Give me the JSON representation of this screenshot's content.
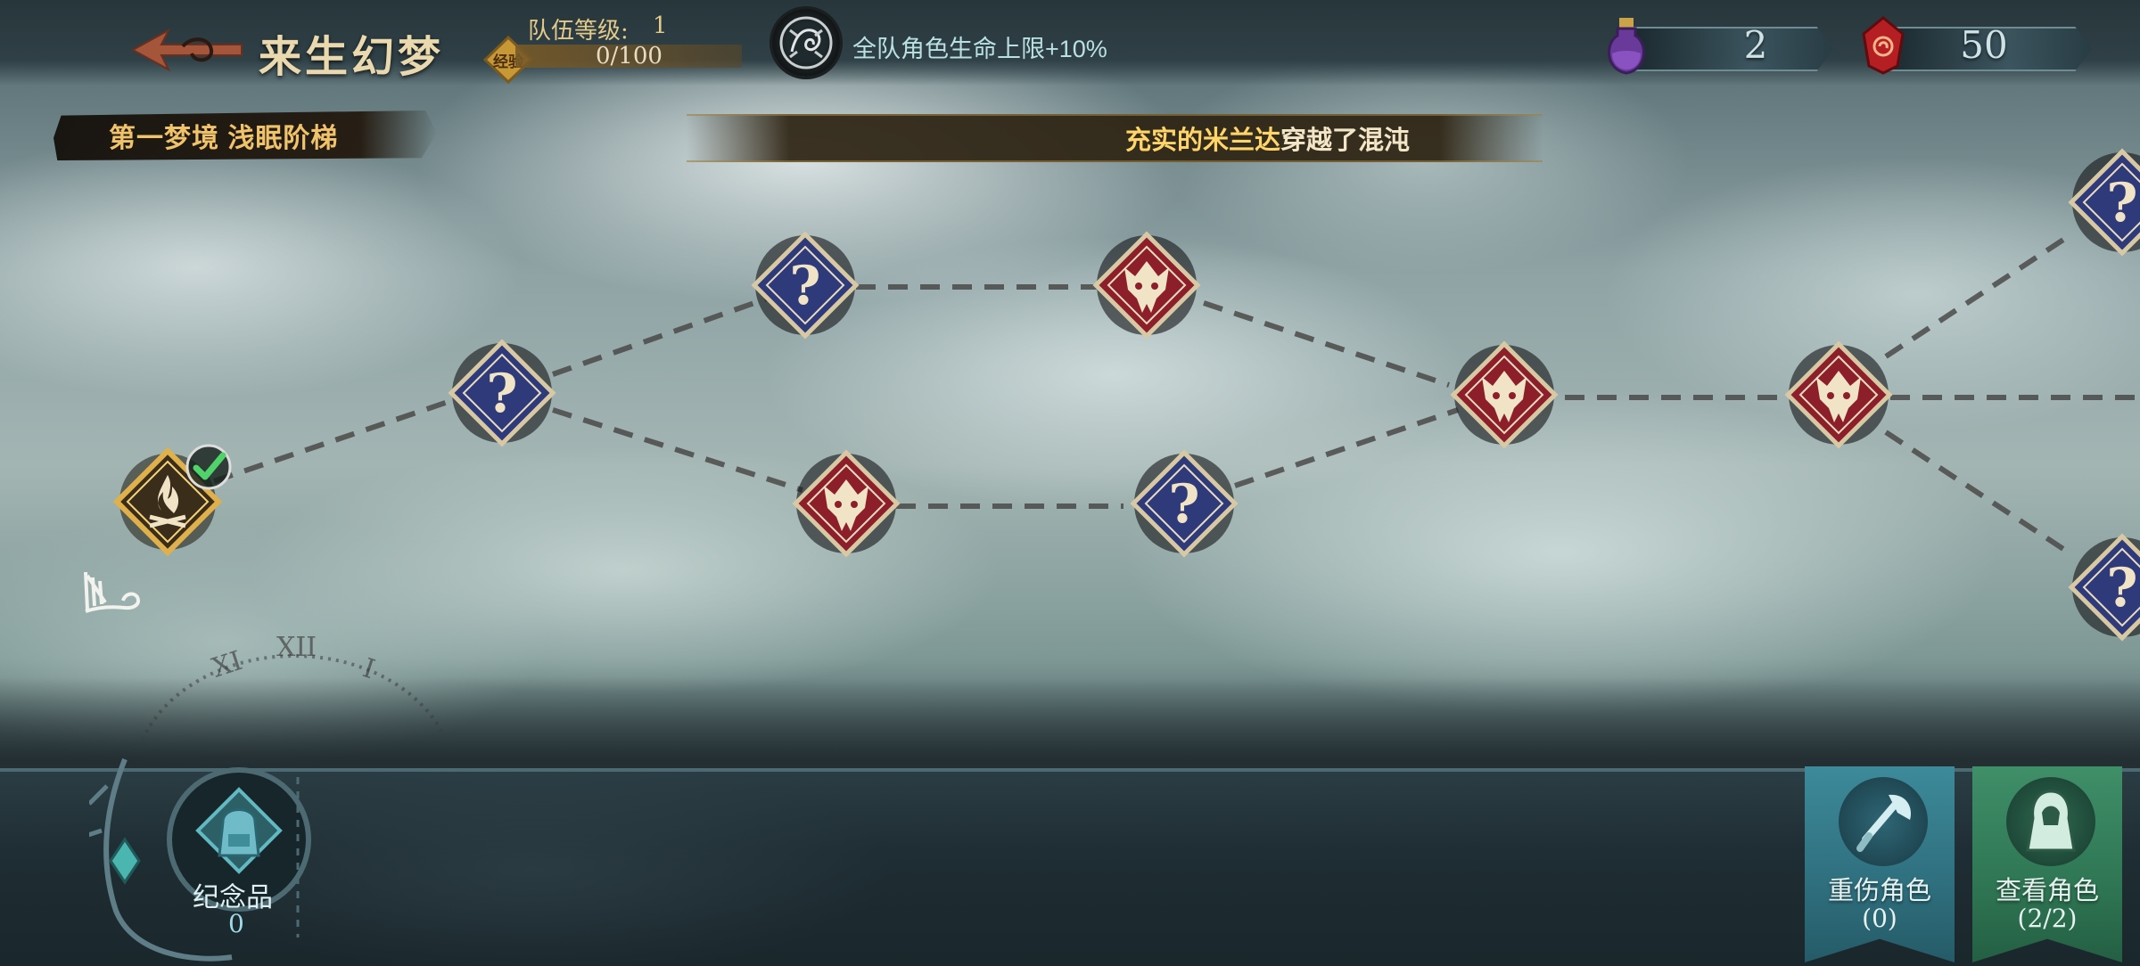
{
  "header": {
    "title": "来生幻梦",
    "team_level_label": "队伍等级:",
    "team_level_value": "1",
    "exp_badge_text": "经验",
    "exp_text": "0/100",
    "buff_text": "全队角色生命上限+10%"
  },
  "resources": {
    "potion": {
      "icon": "potion-icon",
      "value": "2"
    },
    "gem": {
      "icon": "red-gem-icon",
      "value": "50"
    }
  },
  "stage": {
    "name": "第一梦境 浅眠阶梯"
  },
  "ticker": {
    "highlight": "充实的米兰达",
    "rest": "穿越了混沌"
  },
  "nodes": [
    {
      "id": "start",
      "kind": "campfire",
      "cleared": true
    },
    {
      "id": "n1",
      "kind": "mystery"
    },
    {
      "id": "n2",
      "kind": "mystery"
    },
    {
      "id": "n3",
      "kind": "battle"
    },
    {
      "id": "n4",
      "kind": "battle"
    },
    {
      "id": "n5",
      "kind": "mystery"
    },
    {
      "id": "n6",
      "kind": "battle"
    },
    {
      "id": "n7",
      "kind": "battle"
    },
    {
      "id": "n8",
      "kind": "mystery"
    },
    {
      "id": "n9",
      "kind": "mystery"
    }
  ],
  "clock": {
    "numerals": [
      "XI",
      "XII",
      "I"
    ]
  },
  "bottom": {
    "souvenir_label": "纪念品",
    "souvenir_count": "0",
    "injured_label": "重伤角色",
    "injured_count": "(0)",
    "view_label": "查看角色",
    "view_count": "(2/2)"
  },
  "colors": {
    "mystery_node": "#2f3a7a",
    "battle_node": "#8c1f2a",
    "campfire_node": "#c9973a",
    "gold_text": "#f0c36a",
    "buff_text": "#b9e1e3"
  }
}
